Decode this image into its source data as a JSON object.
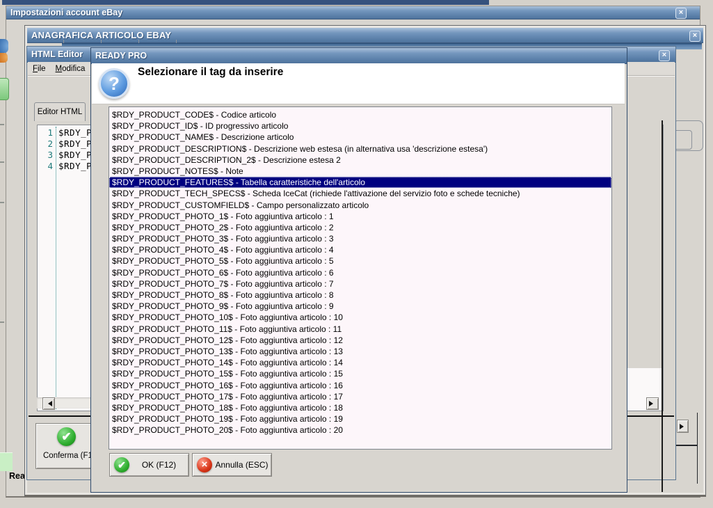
{
  "icons": {
    "close": "×",
    "check": "✔",
    "cancel": "×",
    "question": "?",
    "scroll_left": "left-triangle",
    "scroll_right": "right-triangle"
  },
  "colors": {
    "titlebar_blue": "#5f84ad",
    "selection_navy": "#000080",
    "list_bg": "#fdf6fa",
    "ok_green": "#2fae2f",
    "cancel_red": "#d83418",
    "help_blue": "#2a64b4",
    "desktop_gray": "#d5d1ca"
  },
  "impostazioni": {
    "title": "Impostazioni account eBay",
    "status_text": "Read"
  },
  "anagrafica": {
    "title": "ANAGRAFICA ARTICOLO EBAY"
  },
  "html_editor": {
    "title": "HTML Editor",
    "menu_file": "File",
    "menu_modifica": "Modifica",
    "tab_label": "Editor HTML",
    "code_lines": [
      {
        "num": "1",
        "text": "$RDY_P"
      },
      {
        "num": "2",
        "text": "$RDY_P"
      },
      {
        "num": "3",
        "text": "$RDY_P"
      },
      {
        "num": "4",
        "text": "$RDY_P"
      }
    ],
    "confirm_button": "Conferma (F1"
  },
  "ready_pro": {
    "title": "READY PRO",
    "heading": "Selezionare il tag da inserire",
    "selected_index": 6,
    "tags": [
      "$RDY_PRODUCT_CODE$ - Codice articolo",
      "$RDY_PRODUCT_ID$ - ID progressivo articolo",
      "$RDY_PRODUCT_NAME$ - Descrizione articolo",
      "$RDY_PRODUCT_DESCRIPTION$ - Descrizione web estesa (in alternativa usa 'descrizione estesa')",
      "$RDY_PRODUCT_DESCRIPTION_2$ - Descrizione estesa 2",
      "$RDY_PRODUCT_NOTES$ - Note",
      "$RDY_PRODUCT_FEATURES$ - Tabella caratteristiche dell'articolo",
      "$RDY_PRODUCT_TECH_SPECS$ - Scheda IceCat (richiede l'attivazione del servizio foto e schede tecniche)",
      "$RDY_PRODUCT_CUSTOMFIELD$ - Campo personalizzato articolo",
      "$RDY_PRODUCT_PHOTO_1$ - Foto aggiuntiva articolo : 1",
      "$RDY_PRODUCT_PHOTO_2$ - Foto aggiuntiva articolo : 2",
      "$RDY_PRODUCT_PHOTO_3$ - Foto aggiuntiva articolo : 3",
      "$RDY_PRODUCT_PHOTO_4$ - Foto aggiuntiva articolo : 4",
      "$RDY_PRODUCT_PHOTO_5$ - Foto aggiuntiva articolo : 5",
      "$RDY_PRODUCT_PHOTO_6$ - Foto aggiuntiva articolo : 6",
      "$RDY_PRODUCT_PHOTO_7$ - Foto aggiuntiva articolo : 7",
      "$RDY_PRODUCT_PHOTO_8$ - Foto aggiuntiva articolo : 8",
      "$RDY_PRODUCT_PHOTO_9$ - Foto aggiuntiva articolo : 9",
      "$RDY_PRODUCT_PHOTO_10$ - Foto aggiuntiva articolo : 10",
      "$RDY_PRODUCT_PHOTO_11$ - Foto aggiuntiva articolo : 11",
      "$RDY_PRODUCT_PHOTO_12$ - Foto aggiuntiva articolo : 12",
      "$RDY_PRODUCT_PHOTO_13$ - Foto aggiuntiva articolo : 13",
      "$RDY_PRODUCT_PHOTO_14$ - Foto aggiuntiva articolo : 14",
      "$RDY_PRODUCT_PHOTO_15$ - Foto aggiuntiva articolo : 15",
      "$RDY_PRODUCT_PHOTO_16$ - Foto aggiuntiva articolo : 16",
      "$RDY_PRODUCT_PHOTO_17$ - Foto aggiuntiva articolo : 17",
      "$RDY_PRODUCT_PHOTO_18$ - Foto aggiuntiva articolo : 18",
      "$RDY_PRODUCT_PHOTO_19$ - Foto aggiuntiva articolo : 19",
      "$RDY_PRODUCT_PHOTO_20$ - Foto aggiuntiva articolo : 20"
    ],
    "ok_button": "OK (F12)",
    "cancel_button": "Annulla (ESC)"
  }
}
